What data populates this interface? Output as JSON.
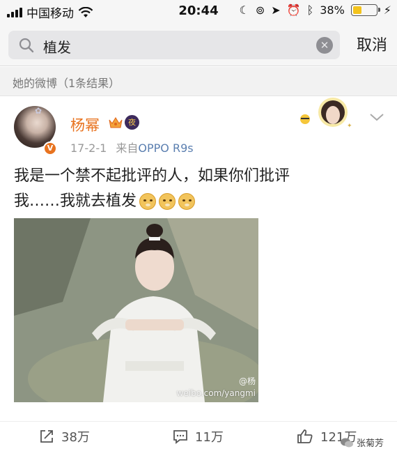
{
  "status_bar": {
    "carrier": "中国移动",
    "time": "20:44",
    "battery_percent": "38%",
    "battery_level": 0.38
  },
  "search": {
    "query": "植发",
    "cancel_label": "取消"
  },
  "section": {
    "label": "她的微博（1条结果）"
  },
  "post": {
    "username": "杨幂",
    "night_badge": "夜",
    "verified_badge": "V",
    "date": "17-2-1",
    "source_prefix": "来自",
    "source": "OPPO R9s",
    "text_line1": "我是一个禁不起批评的人，如果你们批评",
    "text_line2": "我……我就去植发",
    "image_watermark_top": "@杨",
    "image_watermark_url": "weibo.com/yangmi",
    "actions": {
      "repost_count": "38万",
      "comment_count": "11万",
      "like_count": "121万"
    }
  },
  "wechat_watermark": "张菊芳"
}
